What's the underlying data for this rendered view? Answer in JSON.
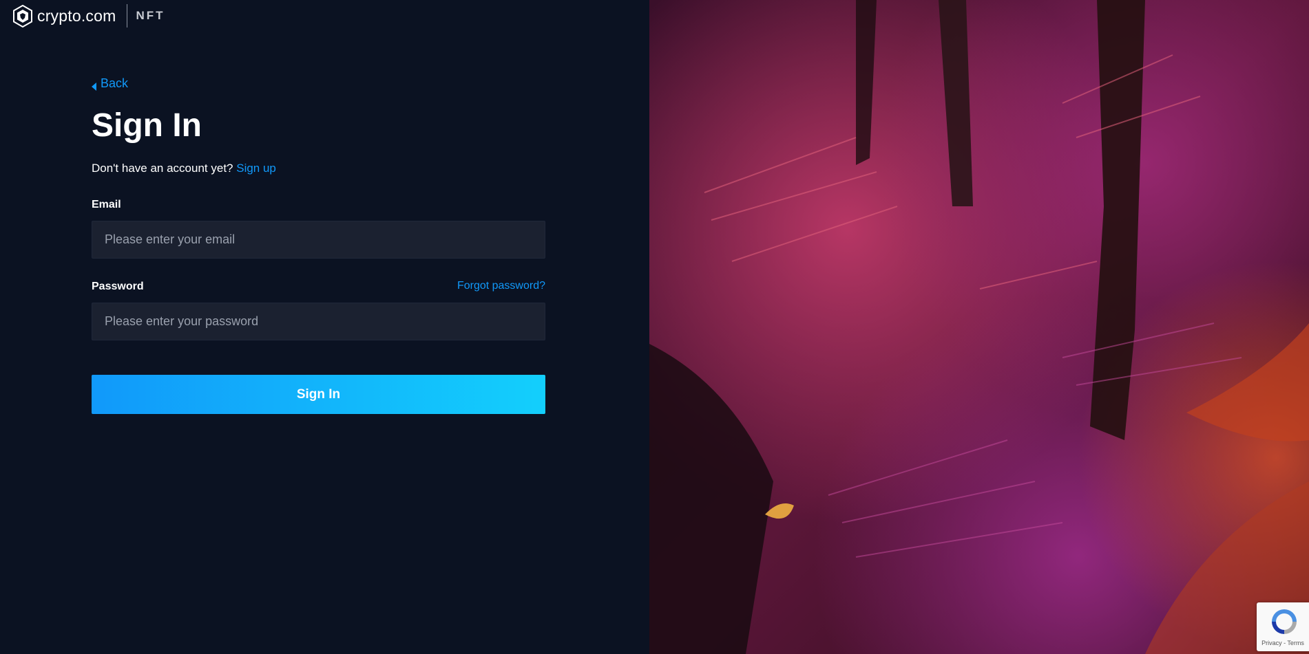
{
  "header": {
    "brand": "crypto.com",
    "product": "NFT",
    "icon": "crypto-com-lion-shield-icon"
  },
  "nav": {
    "back_label": "Back",
    "back_icon": "caret-left-icon"
  },
  "form": {
    "title": "Sign In",
    "signup_prompt": "Don't have an account yet?",
    "signup_link": "Sign up",
    "email_label": "Email",
    "email_placeholder": "Please enter your email",
    "email_value": "",
    "password_label": "Password",
    "password_placeholder": "Please enter your password",
    "password_value": "",
    "forgot_label": "Forgot password?",
    "submit_label": "Sign In"
  },
  "recaptcha": {
    "links": "Privacy - Terms",
    "icon": "recaptcha-icon"
  },
  "colors": {
    "background": "#0b1222",
    "accent": "#1199fa",
    "accent_end": "#13cffc",
    "input_bg": "#1b2130"
  }
}
